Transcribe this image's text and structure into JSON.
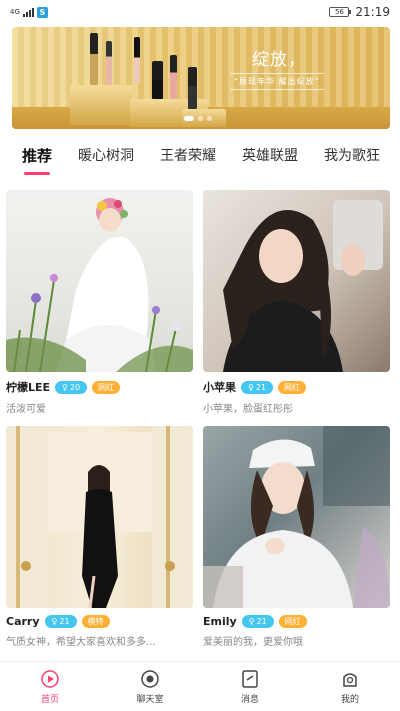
{
  "status_bar": {
    "network": "4G",
    "battery": "56",
    "time": "21:19",
    "app_icon": "weibo-icon"
  },
  "banner": {
    "title": "绽放，",
    "subtitle": "“展现年华 耀出绽放”",
    "colors": {
      "gold": "#e9c56c"
    }
  },
  "tabs": [
    {
      "label": "推荐",
      "active": true
    },
    {
      "label": "暖心树洞",
      "active": false
    },
    {
      "label": "王者荣耀",
      "active": false
    },
    {
      "label": "英雄联盟",
      "active": false
    },
    {
      "label": "我为歌狂",
      "active": false
    }
  ],
  "cards": [
    {
      "nickname": "柠檬LEE",
      "age": "20",
      "tag": "网红",
      "bio": "活泼可爱"
    },
    {
      "nickname": "小苹果",
      "age": "21",
      "tag": "网红",
      "bio": "小苹果，脸蛋红彤彤"
    },
    {
      "nickname": "Carry",
      "age": "21",
      "tag": "模特",
      "bio": "气质女神，希望大家喜欢和多多..."
    },
    {
      "nickname": "Emily",
      "age": "21",
      "tag": "网红",
      "bio": "爱美丽的我，更爱你哦"
    }
  ],
  "bottom_nav": [
    {
      "label": "首页",
      "icon": "home-play-icon",
      "active": true
    },
    {
      "label": "聊天室",
      "icon": "chat-room-icon",
      "active": false
    },
    {
      "label": "消息",
      "icon": "message-icon",
      "active": false
    },
    {
      "label": "我的",
      "icon": "profile-icon",
      "active": false
    }
  ],
  "colors": {
    "accent": "#ff3d6e",
    "age_badge": "#45c6f0",
    "tag_badge": "#ffb035"
  }
}
